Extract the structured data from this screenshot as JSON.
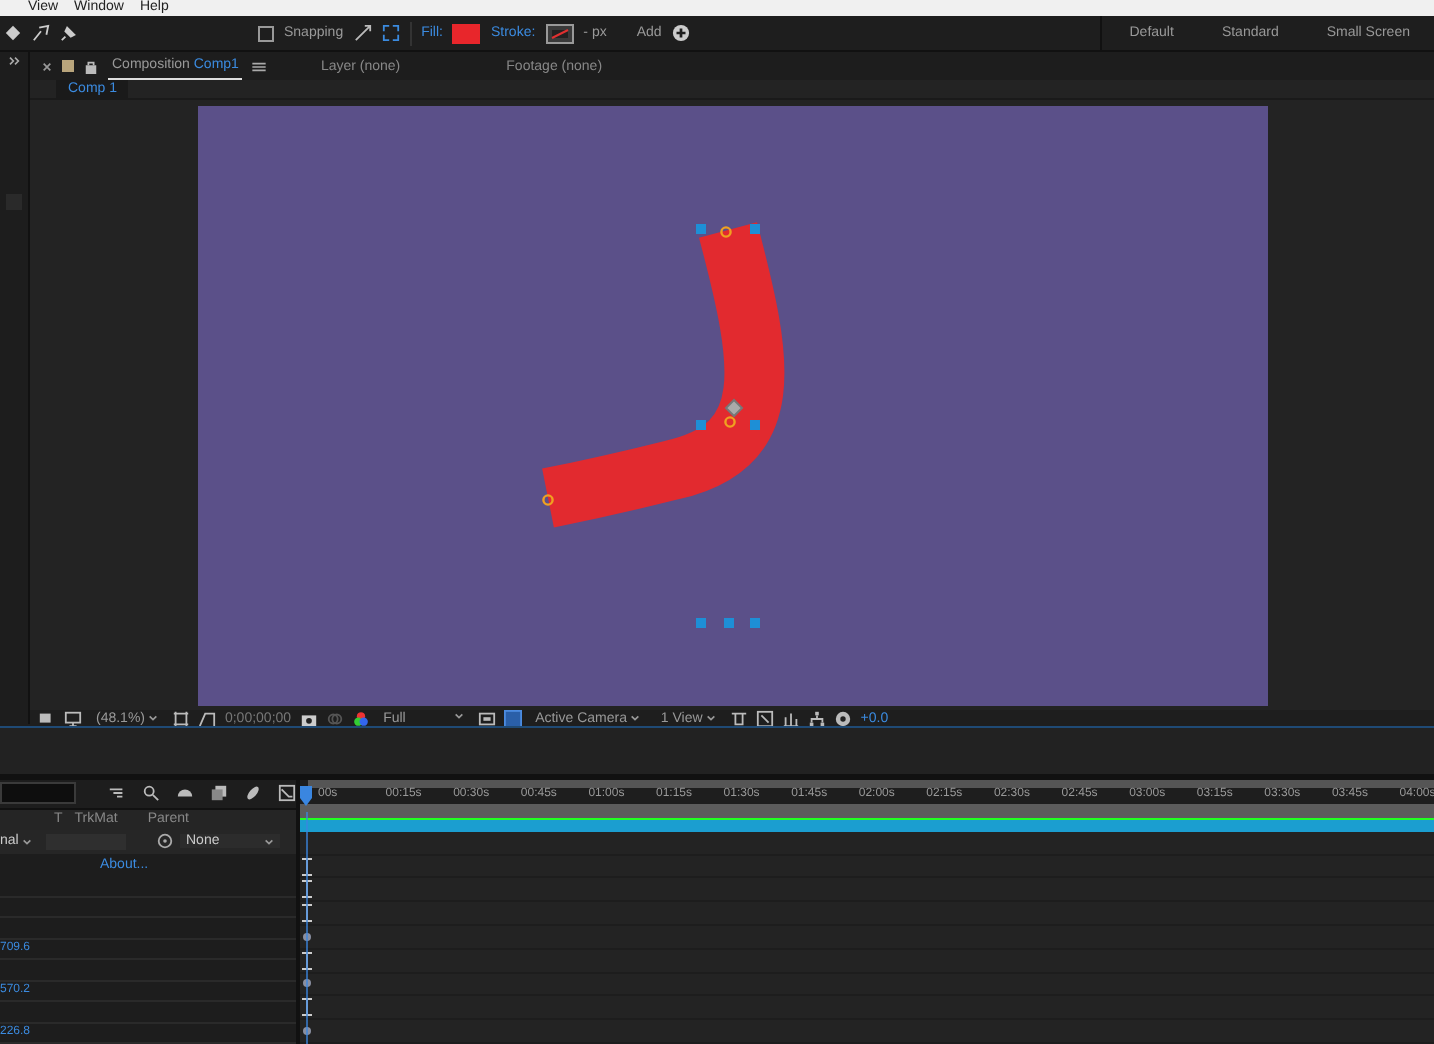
{
  "menu": [
    "View",
    "Window",
    "Help"
  ],
  "toolbar": {
    "snapping": {
      "label": "Snapping",
      "checked": false
    },
    "fill_label": "Fill:",
    "stroke_label": "Stroke:",
    "stroke_width": "- px",
    "add": "Add",
    "workspaces": [
      "Default",
      "Standard",
      "Small Screen"
    ]
  },
  "panel_tabs": [
    {
      "label": "Composition",
      "comp": "Comp1",
      "selected": true
    },
    {
      "label": "Layer (none)",
      "selected": false
    },
    {
      "label": "Footage (none)",
      "selected": false
    }
  ],
  "breadcrumb": "Comp 1",
  "viewer_footer": {
    "zoom": "(48.1%)",
    "timecode": "0;00;00;00",
    "resolution": "Full",
    "camera": "Active Camera",
    "views": "1 View",
    "exposure": "+0.0"
  },
  "timeline": {
    "ruler_labels": [
      "00s",
      "00:15s",
      "00:30s",
      "00:45s",
      "01:00s",
      "01:15s",
      "01:30s",
      "01:45s",
      "02:00s",
      "02:15s",
      "02:30s",
      "02:45s",
      "03:00s",
      "03:15s",
      "03:30s",
      "03:45s",
      "04:00s"
    ],
    "columns": [
      "T",
      "TrkMat",
      "Parent"
    ],
    "layer": {
      "mode": "nal",
      "parent": "None"
    },
    "about": "About...",
    "values": [
      "709.6",
      "570.2",
      "226.8"
    ]
  }
}
